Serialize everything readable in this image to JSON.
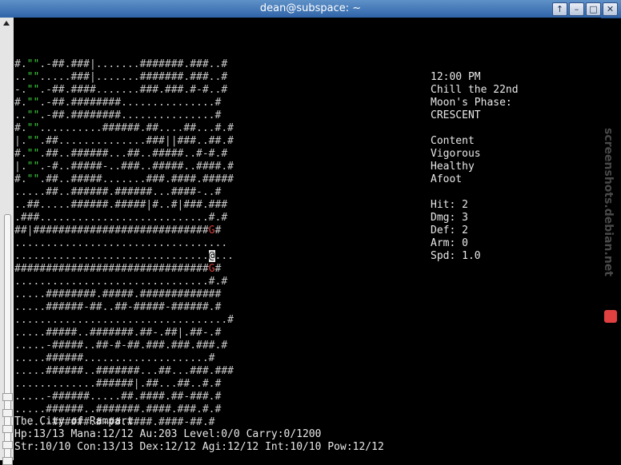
{
  "window": {
    "title": "dean@subspace: ~"
  },
  "map_rows": [
    "#.\"\".-##.###|.......#######.###..#",
    "..\"\".....###|.......#######.###..#",
    "-.\"\".-##.####.......###.###.#-#..#",
    "#.\"\".-##.########...............#",
    "..\"\".-##.########...............#",
    "#.\"\"..........######.##....##...#.#",
    "|.\"\".##..............###||###..##.#",
    "#.\"\".##..######...##..#####..#-#.#",
    "|.\"\".-#..#####-..###..#####..####.#",
    "#.\"\".##..#####.......###.####.#####",
    ".....##..######.######...####-..#",
    "..##.....######.#####|#..#|###.###",
    ".###...........................#.#",
    "##|############################G#",
    "..................................",
    "...............................@...",
    "###############################G#",
    "...............................#.#",
    ".....########.#####.#############",
    ".....######-##..##-#####-######.#",
    "..................................#",
    ".....#####..#######.##-.##|.##-.#",
    ".....-#####..##-#-##.###.###.###.#",
    ".....######....................#",
    ".....######..#######...##...###.###",
    ".............######|.##...##..#.#",
    ".....-######.....##.####.##-###.#",
    ".....######..#######.####.###.#.#",
    ".....-######.#-##.####.####-##.#"
  ],
  "status_panel": {
    "time": "12:00 PM",
    "date": "Chill the 22nd",
    "moon_label": "Moon's Phase:",
    "moon_phase": "CRESCENT",
    "conditions": [
      "Content",
      "Vigorous",
      "Healthy",
      "Afoot"
    ],
    "combat": [
      "Hit: 2",
      "Dmg: 3",
      "Def: 2",
      "Arm: 0",
      "Spd: 1.0"
    ]
  },
  "bottom": {
    "location": "The City of Rampart",
    "line1": "Hp:13/13 Mana:12/12 Au:203 Level:0/0 Carry:0/1200",
    "line2": "Str:10/10 Con:13/13 Dex:12/12 Agi:12/12 Int:10/10 Pow:12/12"
  },
  "watermark": {
    "text": "screenshots.debian.net"
  },
  "icons": {
    "up": "↑",
    "minimize": "–",
    "maximize": "□",
    "close": "✕"
  },
  "colors": {
    "accent": "#2f63a8",
    "quote_green": "#3fd13f",
    "gate_red": "#d23c3c"
  }
}
